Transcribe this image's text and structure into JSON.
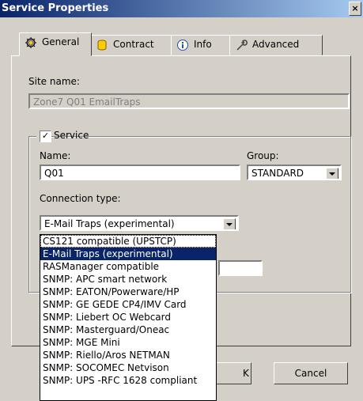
{
  "window": {
    "title": "Service Properties",
    "close_glyph": "×"
  },
  "tabs": [
    {
      "label": "General",
      "icon": "gear-icon",
      "active": true
    },
    {
      "label": "Contract",
      "icon": "database-icon",
      "active": false
    },
    {
      "label": "Info",
      "icon": "info-icon",
      "active": false
    },
    {
      "label": "Advanced",
      "icon": "wrench-icon",
      "active": false
    }
  ],
  "general": {
    "site_name_label": "Site name:",
    "site_name_value": "Zone7 Q01 EmailTraps",
    "service_group_label": "Service",
    "service_checked": true,
    "name_label": "Name:",
    "name_value": "Q01",
    "group_label": "Group:",
    "group_value": "STANDARD",
    "connection_type_label": "Connection type:",
    "connection_type_value": "E-Mail Traps (experimental)",
    "connection_options": [
      "CS121 compatible (UPSTCP)",
      "E-Mail Traps (experimental)",
      "RASManager compatible",
      "SNMP: APC smart network",
      "SNMP: EATON/Powerware/HP",
      "SNMP: GE GEDE CP4/IMV Card",
      "SNMP: Liebert OC Webcard",
      "SNMP: Masterguard/Oneac",
      "SNMP: MGE Mini",
      "SNMP: Riello/Aros NETMAN",
      "SNMP: SOCOMEC Netvison",
      "SNMP: UPS -RFC 1628 compliant"
    ],
    "selected_option_index": 1,
    "hover_option_index": 0
  },
  "buttons": {
    "ok_fragment": "K",
    "cancel": "Cancel"
  },
  "colors": {
    "title_start": "#0a246a",
    "title_end": "#a6caf0",
    "selection": "#0a246a",
    "face": "#d4d0c8"
  }
}
